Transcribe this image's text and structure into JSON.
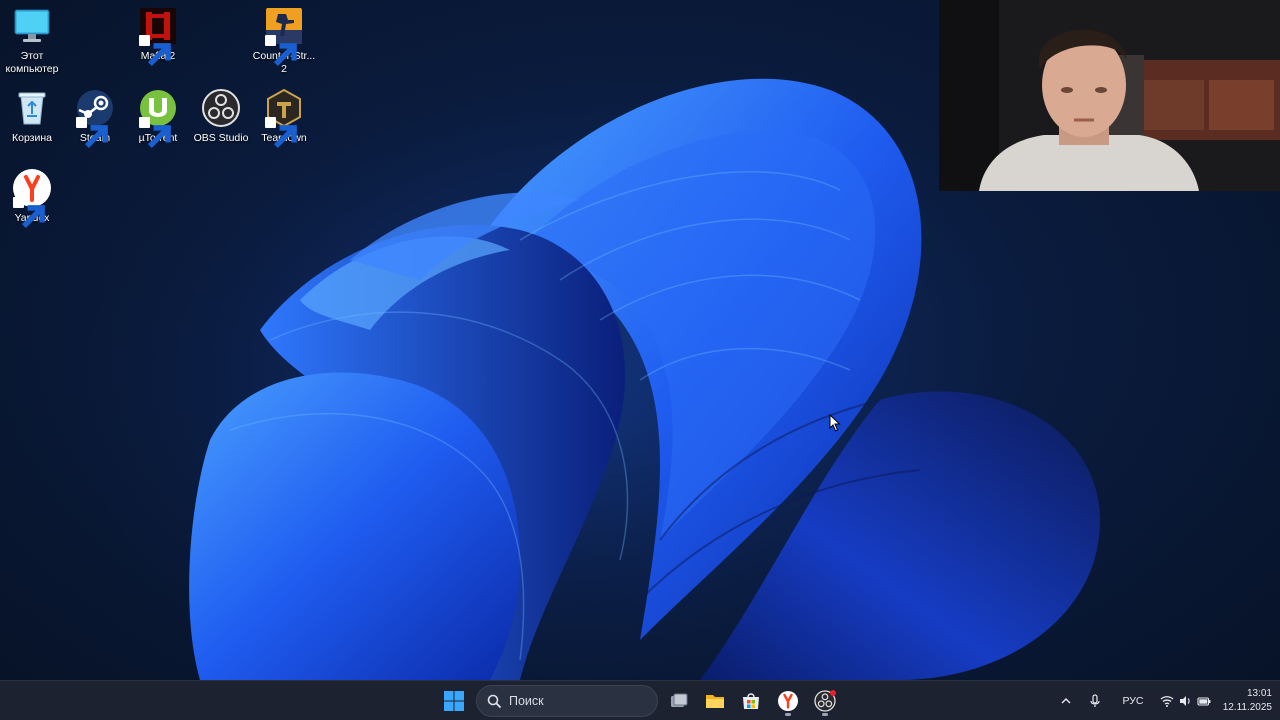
{
  "desktop": {
    "icons": [
      {
        "label": "Этот компьютер",
        "icon": "monitor-icon"
      },
      {
        "label": "Mafia 2",
        "icon": "mafia-icon"
      },
      {
        "label": "Counter-Str... 2",
        "icon": "counter-strike-icon"
      },
      {
        "label": "Корзина",
        "icon": "recycle-bin-icon"
      },
      {
        "label": "Steam",
        "icon": "steam-icon"
      },
      {
        "label": "µTorrent",
        "icon": "utorrent-icon"
      },
      {
        "label": "OBS Studio",
        "icon": "obs-icon"
      },
      {
        "label": "Teardown",
        "icon": "teardown-icon"
      },
      {
        "label": "Yandex",
        "icon": "yandex-icon"
      }
    ]
  },
  "taskbar": {
    "search_placeholder": "Поиск",
    "apps": [
      "start-icon",
      "task-view-icon",
      "file-explorer-icon",
      "store-icon",
      "yandex-browser-icon",
      "obs-icon"
    ],
    "tray": {
      "language": "РУС",
      "time": "13:01",
      "date": "12.11.2025"
    }
  },
  "colors": {
    "taskbar_bg": "#1c2230",
    "wallpaper_accent": "#1e5bff",
    "wallpaper_bg": "#0a1b3d"
  }
}
